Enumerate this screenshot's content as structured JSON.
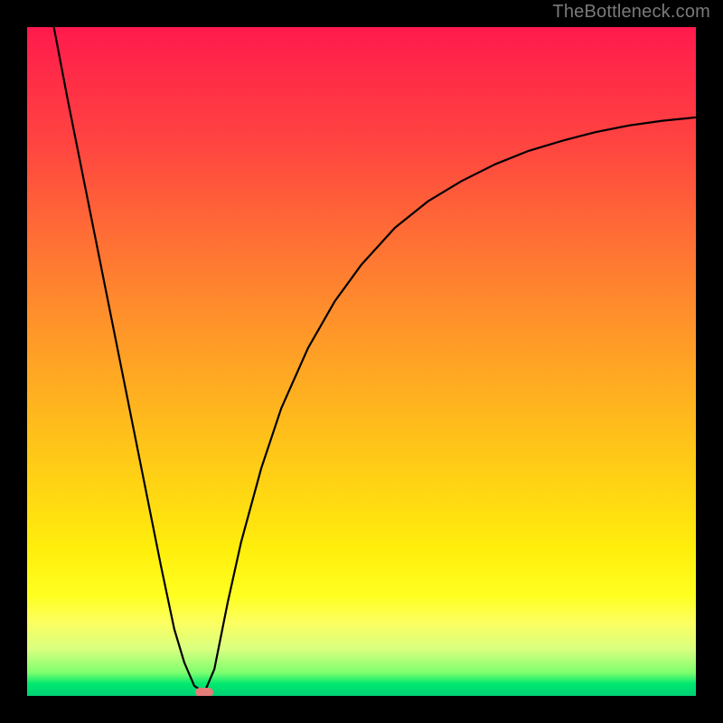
{
  "watermark": "TheBottleneck.com",
  "chart_data": {
    "type": "line",
    "title": "",
    "xlabel": "",
    "ylabel": "",
    "xlim": [
      0,
      100
    ],
    "ylim": [
      0,
      100
    ],
    "grid": false,
    "legend": false,
    "background": "red-yellow-green vertical gradient",
    "series": [
      {
        "name": "left-branch",
        "x": [
          4,
          6,
          8,
          10,
          12,
          14,
          16,
          18,
          20,
          22,
          23.5,
          25,
          26.5
        ],
        "y": [
          100,
          89.5,
          79.5,
          69.5,
          59.5,
          49.5,
          39.5,
          29.5,
          19.5,
          10,
          5,
          1.5,
          0.5
        ]
      },
      {
        "name": "right-branch",
        "x": [
          26.5,
          28,
          30,
          32,
          35,
          38,
          42,
          46,
          50,
          55,
          60,
          65,
          70,
          75,
          80,
          85,
          90,
          95,
          100
        ],
        "y": [
          0.5,
          4,
          14,
          23,
          34,
          43,
          52,
          59,
          64.5,
          70,
          74,
          77,
          79.5,
          81.5,
          83,
          84.3,
          85.3,
          86,
          86.5
        ]
      }
    ],
    "marker": {
      "x": 26.5,
      "y": 0.5,
      "shape": "rounded-rect",
      "color": "#e27d7a"
    }
  }
}
